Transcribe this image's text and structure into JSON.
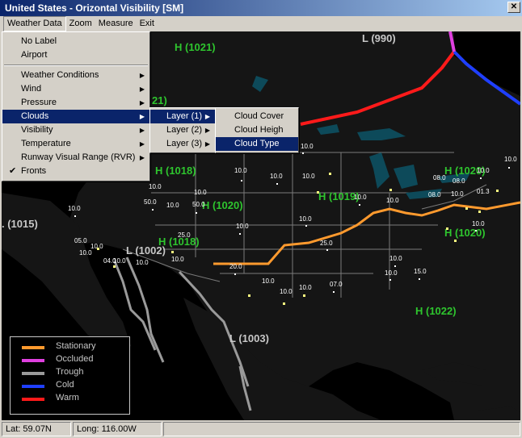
{
  "window": {
    "title": "United States  - Orizontal Visibility [SM]"
  },
  "menubar": [
    "Weather Data",
    "Zoom",
    "Measure",
    "Exit"
  ],
  "weather_menu": {
    "top": [
      "No Label",
      "Airport"
    ],
    "items": [
      {
        "label": "Weather Conditions",
        "arrow": true
      },
      {
        "label": "Wind",
        "arrow": true
      },
      {
        "label": "Pressure",
        "arrow": true
      },
      {
        "label": "Clouds",
        "arrow": true,
        "selected": true
      },
      {
        "label": "Visibility",
        "arrow": true
      },
      {
        "label": "Temperature",
        "arrow": true
      },
      {
        "label": "Runway Visual Range (RVR)",
        "arrow": true
      },
      {
        "label": "Fronts",
        "checked": true
      }
    ]
  },
  "clouds_submenu": [
    "Layer (1)",
    "Layer (2)",
    "Layer (3)"
  ],
  "layer_submenu": [
    "Cloud Cover",
    "Cloud Heigh",
    "Cloud Type"
  ],
  "pressure_labels": [
    {
      "type": "H",
      "text": "H (1021)"
    },
    {
      "type": "L",
      "text": "L (990)"
    },
    {
      "type": "H",
      "text": "21)"
    },
    {
      "type": "H",
      "text": "H (1018)"
    },
    {
      "type": "H",
      "text": "H (1019)"
    },
    {
      "type": "H",
      "text": "H (1020)"
    },
    {
      "type": "H",
      "text": "H (1020)"
    },
    {
      "type": "H",
      "text": "H (1018)"
    },
    {
      "type": "H",
      "text": "H (1020)"
    },
    {
      "type": "L",
      "text": ". (1015)"
    },
    {
      "type": "L",
      "text": "L (1002)"
    },
    {
      "type": "L",
      "text": "L (1003)"
    },
    {
      "type": "H",
      "text": "H (1022)"
    }
  ],
  "stations": [
    "10.0",
    "10.0",
    "10.0",
    "50.0",
    "10.0",
    "50.0",
    "05.0",
    "10.0",
    "10.0",
    "04.0",
    "10.0",
    "10.0",
    "25.0",
    "10.0",
    "10.0",
    "10.0",
    "10.0",
    "10.0",
    "10.0",
    "10.0",
    "20.0",
    "25.0",
    "10.0",
    "10.0",
    "10.0",
    "07.0",
    "10.0",
    "08.0",
    "10.0",
    "08.0",
    "10.0",
    "10.0",
    "15.0",
    "10.0",
    "10.0",
    "10.0",
    "01.3",
    "08.0",
    "10.0"
  ],
  "legend": [
    {
      "label": "Stationary",
      "color": "#ff9a2e"
    },
    {
      "label": "Occluded",
      "color": "#e040e0"
    },
    {
      "label": "Trough",
      "color": "#9a9a9a"
    },
    {
      "label": "Cold",
      "color": "#1f3fff"
    },
    {
      "label": "Warm",
      "color": "#ff1a1a"
    }
  ],
  "status": {
    "lat": "Lat: 59.07N",
    "long": "Long: 116.00W"
  }
}
